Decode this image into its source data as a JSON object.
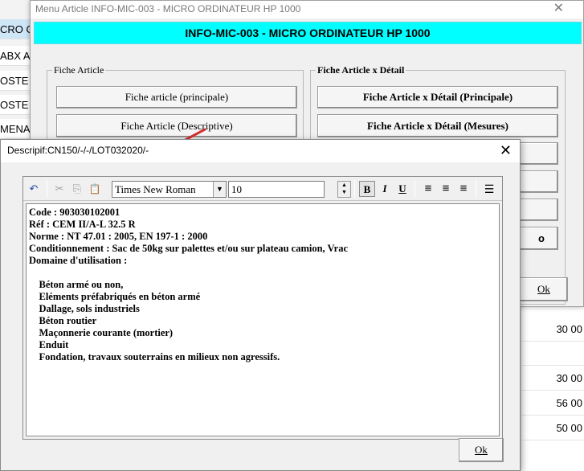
{
  "background_list": {
    "rows": [
      {
        "text": "CRO O",
        "selected": true
      },
      {
        "text": "ABX AL",
        "selected": false
      },
      {
        "text": "OSTE S",
        "selected": false
      },
      {
        "text": "OSTE S",
        "selected": false
      },
      {
        "text": "MENAG",
        "selected": false
      }
    ]
  },
  "background_values": [
    "30 00",
    "",
    "30 00",
    "56 00",
    "50 00"
  ],
  "menu_window": {
    "title": "Menu Article INFO-MIC-003 - MICRO ORDINATEUR HP 1000",
    "close_glyph": "✕",
    "header": "INFO-MIC-003 - MICRO ORDINATEUR HP 1000",
    "fiche_article": {
      "label": "Fiche Article",
      "buttons": [
        "Fiche article (principale)",
        "Fiche Article (Descriptive)"
      ]
    },
    "fiche_detail": {
      "label": "Fiche Article x Détail",
      "buttons": [
        "Fiche Article x Détail (Principale)",
        "Fiche Article x Détail (Mesures)"
      ]
    },
    "partial_button_glyph": "o",
    "ok_label": "Ok"
  },
  "desc_dialog": {
    "title": "Descripif:CN150/-/-/LOT032020/-",
    "close_glyph": "✕",
    "toolbar": {
      "undo": "↶",
      "cut": "✂",
      "copy": "⎘",
      "paste": "📋",
      "font_name": "Times New Roman",
      "dropdown_glyph": "▼",
      "font_size": "10",
      "spin_up": "▲",
      "spin_down": "▼",
      "bold": "B",
      "italic": "I",
      "underline": "U",
      "align_left": "≡",
      "align_center": "≡",
      "align_right": "≡",
      "bullets": "☰"
    },
    "content_lines": [
      "Code : 903030102001",
      "Réf : CEM II/A-L 32.5 R",
      "Norme : NT 47.01 : 2005, EN 197-1 : 2000",
      "Conditionnement : Sac de 50kg sur palettes et/ou sur plateau camion, Vrac",
      "Domaine d'utilisation :",
      "",
      "    Béton armé ou non,",
      "    Eléments préfabriqués en béton armé",
      "    Dallage, sols industriels",
      "    Béton routier",
      "    Maçonnerie courante (mortier)",
      "    Enduit",
      "    Fondation, travaux souterrains en milieux non agressifs."
    ],
    "ok_label": "Ok"
  }
}
